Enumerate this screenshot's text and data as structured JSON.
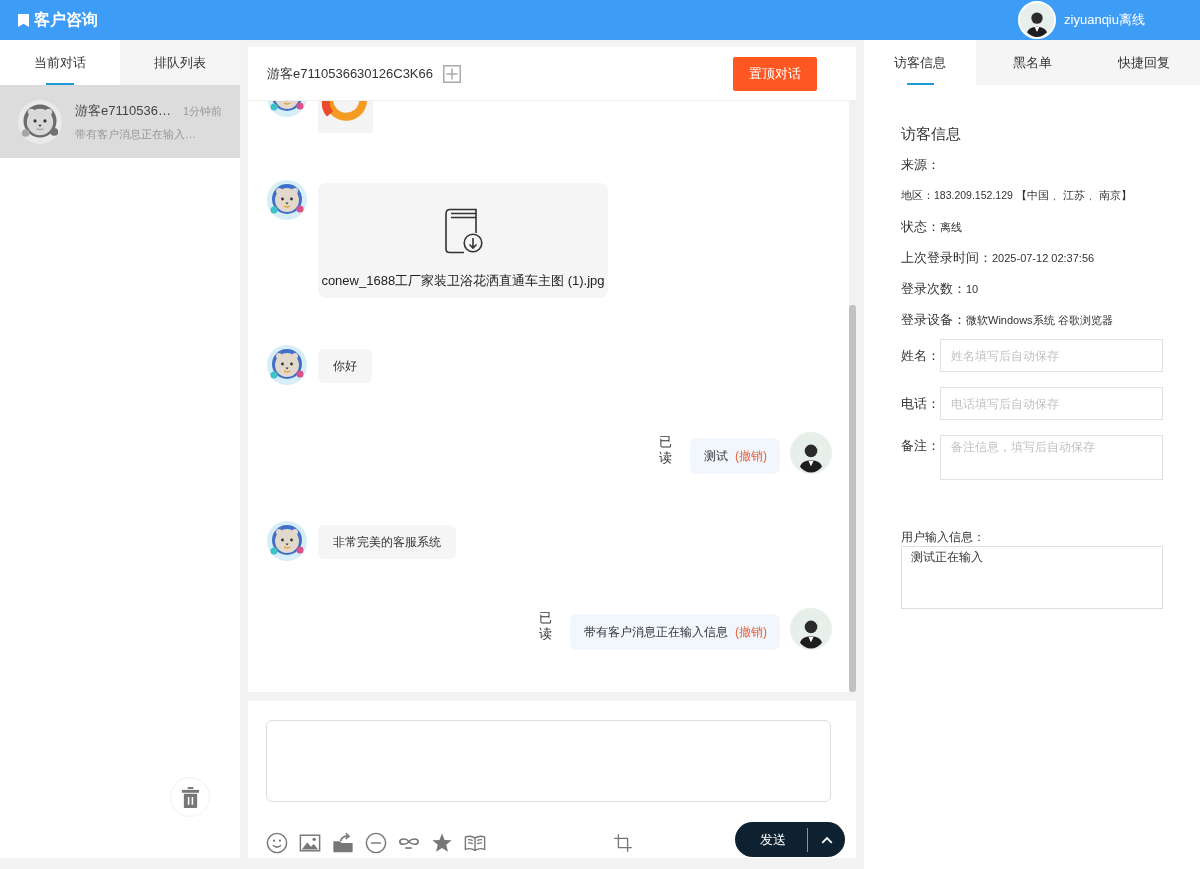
{
  "topbar": {
    "title": "客户咨询",
    "user": "ziyuanqiu离线"
  },
  "left_tabs": [
    {
      "label": "当前对话",
      "selected": true
    },
    {
      "label": "排队列表",
      "selected": false
    }
  ],
  "conversations": [
    {
      "name": "游客e7110536…",
      "time": "1分钟前",
      "preview": "带有客户消息正在输入…",
      "selected": true,
      "offline": true
    }
  ],
  "chat": {
    "title": "游客e7110536630126C3K66",
    "pin_button": "置顶对话",
    "messages": [
      {
        "outgoing": false,
        "kind": "image"
      },
      {
        "outgoing": false,
        "kind": "file",
        "filename": "conew_1688工厂家装卫浴花洒直通车主图 (1).jpg"
      },
      {
        "outgoing": false,
        "kind": "text",
        "text": "你好"
      },
      {
        "outgoing": true,
        "kind": "text",
        "text": "测试",
        "recall": "(撤销)",
        "receipt": "已读"
      },
      {
        "outgoing": false,
        "kind": "text",
        "text": "非常完美的客服系统"
      },
      {
        "outgoing": true,
        "kind": "text",
        "text": "带有客户消息正在输入信息",
        "recall": "(撤销)",
        "receipt": "已读"
      }
    ]
  },
  "composer": {
    "send_button": "发送"
  },
  "right_tabs": [
    {
      "label": "访客信息",
      "selected": true
    },
    {
      "label": "黑名单",
      "selected": false
    },
    {
      "label": "快捷回复",
      "selected": false
    }
  ],
  "visitor_info": {
    "heading": "访客信息",
    "rows": [
      {
        "kind": "pair",
        "label": "来源："
      },
      {
        "kind": "line",
        "text": "地区：183.209.152.129 【中国 、江苏 、南京】"
      },
      {
        "kind": "pair",
        "label": "状态：",
        "value": "离线"
      },
      {
        "kind": "pair",
        "label": "上次登录时间：",
        "value": "2025-07-12 02:37:56"
      },
      {
        "kind": "pair",
        "label": "登录次数：",
        "value": "10"
      },
      {
        "kind": "pair",
        "label": "登录设备：",
        "value": "微软Windows系统 谷歌浏览器"
      }
    ],
    "fields": [
      {
        "kind": "input",
        "label": "姓名：",
        "placeholder": "姓名填写后自动保存"
      },
      {
        "kind": "input",
        "label": "电话：",
        "placeholder": "电话填写后自动保存"
      },
      {
        "kind": "textarea",
        "label": "备注：",
        "placeholder": "备注信息，填写后自动保存"
      }
    ],
    "typing": {
      "label": "用户输入信息：",
      "value": "测试正在输入"
    }
  }
}
